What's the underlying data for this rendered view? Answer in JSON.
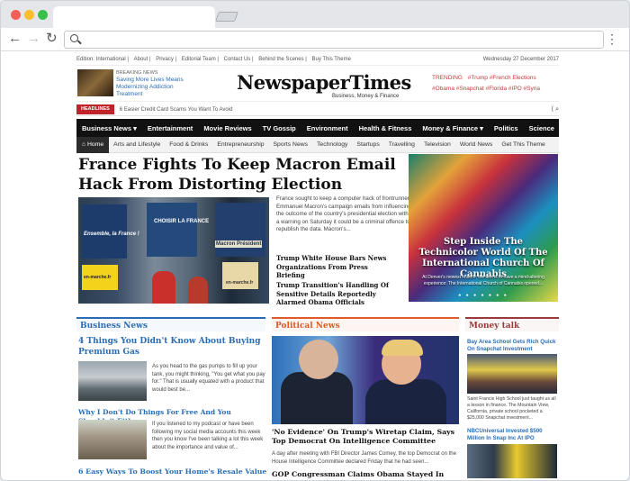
{
  "browser": {
    "url": ""
  },
  "topbar": {
    "links": [
      "Edition: International",
      "About",
      "Privacy",
      "Editorial Team",
      "Contact Us",
      "Behind the Scenes",
      "Buy This Theme"
    ],
    "date": "Wednesday 27 December 2017"
  },
  "header": {
    "breaking_label": "BREAKING NEWS",
    "breaking_text": "Saving More Lives Means Modernizing Addiction Treatment",
    "logo": "NewspaperTimes",
    "tagline": "Business, Money & Finance",
    "trending_label": "TRENDING",
    "trending_tags_1": "#Trump  #French Elections",
    "trending_tags_2": "#Obama  #Snapchat  #Florida  #IPO  #Syria"
  },
  "headlines": {
    "label": "HEADLINES",
    "text": "6 Easier Credit Card Scams You Want To Avoid"
  },
  "main_nav": [
    "Business News ▾",
    "Entertainment",
    "Movie Reviews",
    "TV Gossip",
    "Environment",
    "Health & Fitness",
    "Money & Finance ▾",
    "Politics",
    "Science"
  ],
  "sub_nav": [
    "Arts and Lifestyle",
    "Food & Drinks",
    "Entrepreneurship",
    "Sports News",
    "Technology",
    "Startups",
    "Travelling",
    "Television",
    "World News",
    "Get This Theme"
  ],
  "sub_nav_home": "Home",
  "hero": {
    "title": "France Fights To Keep Macron Email Hack From Distorting Election",
    "summary": "France sought to keep a computer hack of frontrunner Emmanuel Macron's campaign emails from influencing the outcome of the country's presidential election with a warning on Saturday it could be a criminal offence to republish the data. Macron's...",
    "related_1": "Trump White House Bars News Organizations From Press Briefing",
    "related_2": "Trump Transition's Handling Of Sensitive Details Reportedly Alarmed Obama Officials",
    "img_caption_1": "Ensemble, la France !",
    "img_caption_2": "CHOISIR LA FRANCE",
    "img_caption_3": "Macron Président",
    "img_caption_4": "en-marche.fr",
    "img_caption_5": "en-marche.fr"
  },
  "feature": {
    "title": "Step Inside The Technicolor World Of The International Church Of Cannabis",
    "summary": "At Denver's newest church, the aim is to have a mind-altering experience: The International Church of Cannabis opened...",
    "dots": "● ● ● ● ● ● ●"
  },
  "business": {
    "heading": "Business News",
    "a1_title": "4 Things You Didn't Know About Buying Premium Gas",
    "a1_text": "As you head to the gas pumps to fill up your tank, you might thinking, \"You get what you pay for.\" That is usually equated with a product that would best be...",
    "a2_title": "Why I Don't Do Things For Free And You Shouldn't Either",
    "a2_text": "If you listened to my podcast or have been following my social media accounts this week then you know I've been talking a lot this week about the importance and value of...",
    "a3_title": "6 Easy Ways To Boost Your Home's Resale Value"
  },
  "politics": {
    "heading": "Political News",
    "a1_title": "'No Evidence' On Trump's Wiretap Claim, Says Top Democrat On Intelligence Committee",
    "a1_text": "A day after meeting with FBI Director James Comey, the top Democrat on the House Intelligence Committee declared Friday that he had seen...",
    "a2_title": "GOP Congressman Claims Obama Stayed In"
  },
  "money": {
    "heading": "Money talk",
    "a1_title": "Bay Area School Gets Rich Quick On Snapchat Investment",
    "a1_text": "Saint Francis High School just taught us all a lesson in finance. The Mountain View, California, private school pocketed a $25,000 Snapchat investment...",
    "a2_title": "NBCUniversal Invested $500 Million In Snap Inc At IPO"
  }
}
